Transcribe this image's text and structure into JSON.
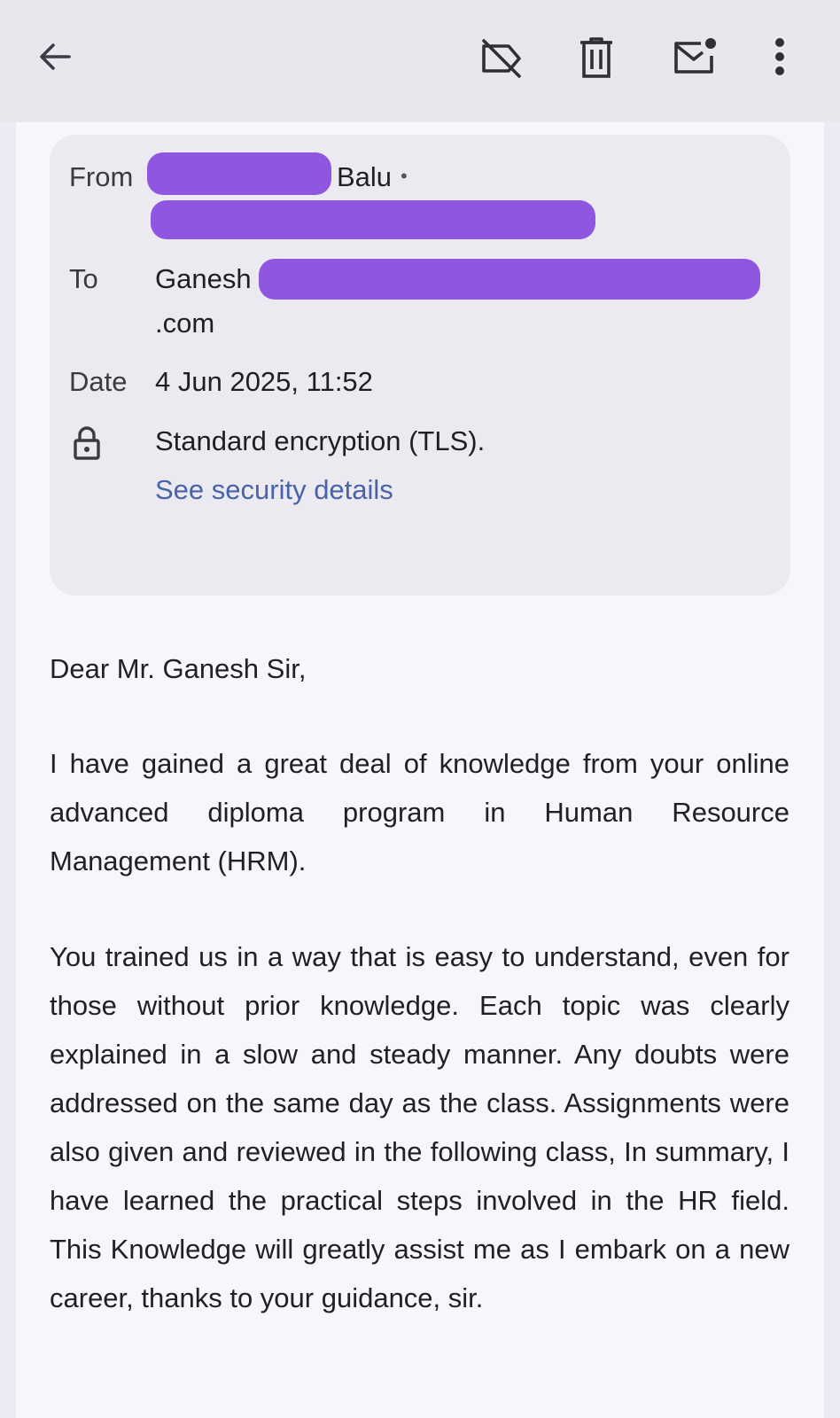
{
  "toolbar": {
    "back": "back-arrow-icon",
    "label": "label-off-icon",
    "delete": "trash-icon",
    "unread": "mark-unread-icon",
    "more": "more-vert-icon"
  },
  "header": {
    "from_label": "From",
    "from_name": "Balu",
    "from_dot": "•",
    "to_label": "To",
    "to_name": "Ganesh",
    "to_domain": ".com",
    "date_label": "Date",
    "date_value": "4 Jun 2025, 11:52",
    "encryption_text": "Standard encryption (TLS).",
    "security_link": "See security details"
  },
  "body": {
    "greeting": "Dear Mr. Ganesh Sir,",
    "paragraph1": "I have gained a great deal of knowledge from your online advanced diploma program in Human Resource Management (HRM).",
    "paragraph2": "You trained us in a way that is easy to understand, even for those without prior knowledge. Each topic was clearly explained in a slow and steady manner. Any doubts were addressed on the same day as the class. Assignments were also given and reviewed in the following class, In summary, I have learned the practical steps involved in the HR field. This Knowledge will greatly assist me as I embark on a new career, thanks to your guidance, sir."
  },
  "colors": {
    "redaction": "#8f56e0",
    "link": "#4a63a8"
  }
}
